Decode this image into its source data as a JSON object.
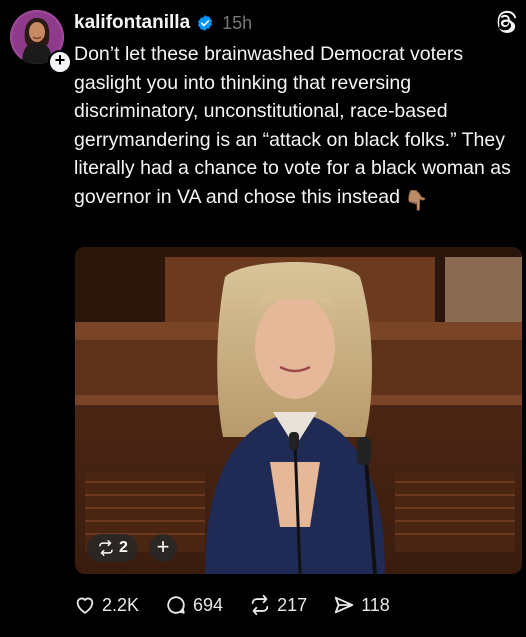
{
  "post": {
    "username": "kalifontanilla",
    "timestamp": "15h",
    "text": "Don’t let these brainwashed Democrat voters gaslight you into thinking that reversing discriminatory, unconstitutional, race-based gerrymandering is an “attack on black folks.” They literally had a chance to vote for a black woman as governor in VA and chose this instead",
    "hand_emoji": "👇🏽"
  },
  "media": {
    "repost_count": "2",
    "add_symbol": "+"
  },
  "actions": {
    "likes": "2.2K",
    "replies": "694",
    "reposts": "217",
    "shares": "118"
  },
  "icons": {
    "avatar": "profile-avatar",
    "verified": "verified-badge-icon",
    "threads": "threads-logo-icon",
    "like": "heart-icon",
    "reply": "comment-icon",
    "repost": "repost-icon",
    "share": "send-icon"
  },
  "colors": {
    "background": "#000000",
    "verified": "#0095f6",
    "text": "#f3f5f7",
    "muted": "#777777"
  }
}
